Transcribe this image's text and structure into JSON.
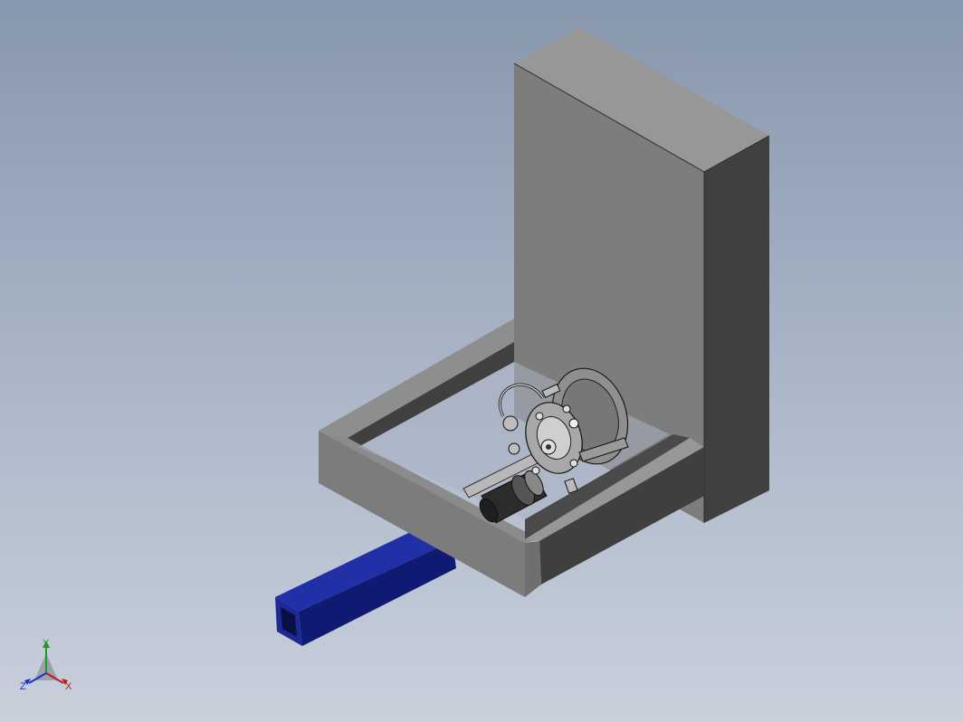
{
  "viewport": {
    "background_top": "#8797ad",
    "background_bottom": "#c9d0dc"
  },
  "model": {
    "wall_face_color": "#7d7d7d",
    "wall_top_color": "#979797",
    "wall_side_color": "#404040",
    "frame_top_color": "#909090",
    "frame_side_color": "#3f3f3f",
    "tube_color": "#1b2a94",
    "tube_dark_color": "#0d165c"
  },
  "triad": {
    "x_label": "X",
    "y_label": "Y",
    "z_label": "Z",
    "x_color": "#c0181e",
    "y_color": "#1c9a2a",
    "z_color": "#1c2fc0"
  }
}
